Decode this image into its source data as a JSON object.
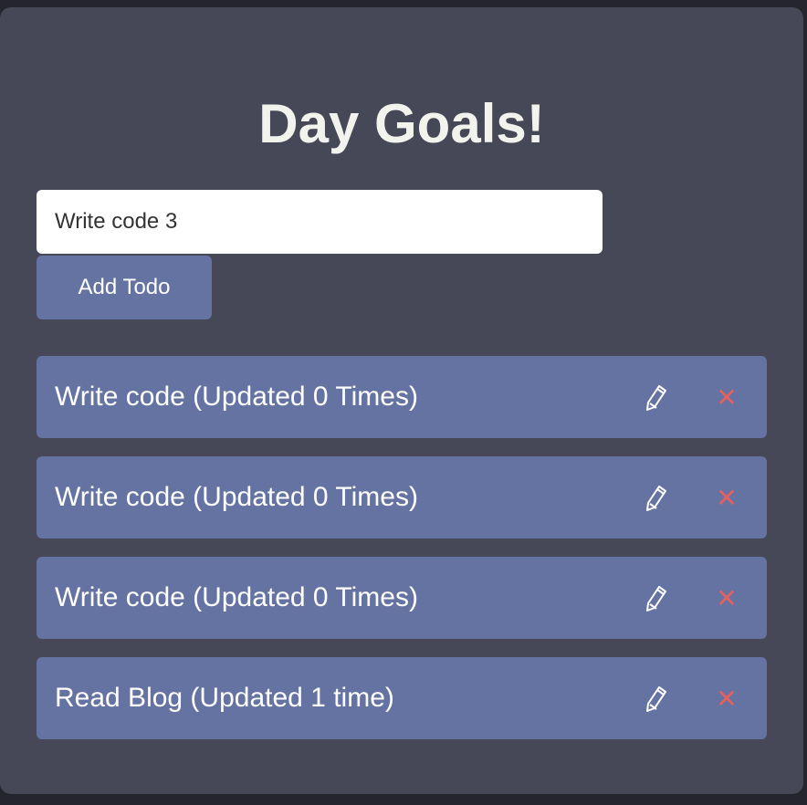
{
  "header": {
    "title": "Day Goals!"
  },
  "form": {
    "input_value": "Write code 3",
    "add_button_label": "Add Todo"
  },
  "todos": [
    {
      "text": "Write code (Updated 0 Times)",
      "edit_icon": "pencil-icon",
      "delete_icon": "close-icon"
    },
    {
      "text": "Write code (Updated 0 Times)",
      "edit_icon": "pencil-icon",
      "delete_icon": "close-icon"
    },
    {
      "text": "Write code (Updated 0 Times)",
      "edit_icon": "pencil-icon",
      "delete_icon": "close-icon"
    },
    {
      "text": "Read Blog (Updated 1 time)",
      "edit_icon": "pencil-icon",
      "delete_icon": "close-icon"
    }
  ],
  "colors": {
    "page_background": "#25262d",
    "card_background": "#464857",
    "item_background": "#6573a2",
    "title_text": "#f3f3ee",
    "delete_icon": "#e5615e"
  }
}
